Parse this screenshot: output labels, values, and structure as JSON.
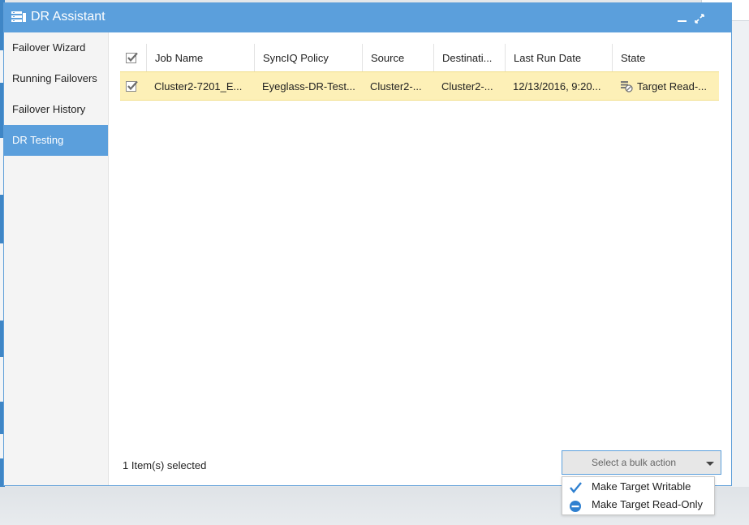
{
  "window": {
    "title": "DR Assistant"
  },
  "sidebar": {
    "items": [
      {
        "label": "Failover Wizard"
      },
      {
        "label": "Running Failovers"
      },
      {
        "label": "Failover History"
      },
      {
        "label": "DR Testing",
        "active": true
      }
    ]
  },
  "grid": {
    "columns": [
      "Job Name",
      "SyncIQ Policy",
      "Source",
      "Destinati...",
      "Last Run Date",
      "State"
    ],
    "rows": [
      {
        "checked": true,
        "job_name": "Cluster2-7201_E...",
        "policy": "Eyeglass-DR-Test...",
        "source": "Cluster2-...",
        "destination": "Cluster2-...",
        "last_run": "12/13/2016, 9:20...",
        "state": "Target Read-...",
        "state_icon": "target-readonly-icon"
      }
    ]
  },
  "footer": {
    "selected_text": "1 Item(s) selected"
  },
  "bulk_action": {
    "placeholder": "Select a bulk action",
    "options": [
      {
        "label": "Make Target Writable",
        "icon": "checkmark-icon"
      },
      {
        "label": "Make Target Read-Only",
        "icon": "minus-circle-icon"
      }
    ]
  },
  "colors": {
    "accent": "#5b9fdc",
    "selected_row": "#fdf0b7",
    "checkmark": "#2f80d0"
  }
}
